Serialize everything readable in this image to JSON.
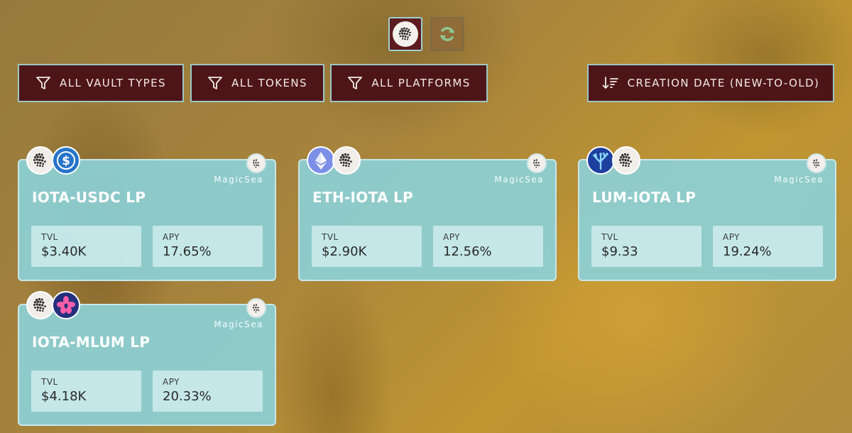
{
  "chains": [
    {
      "name": "IOTA",
      "icon": "iota-icon",
      "active": true
    },
    {
      "name": "Other chain",
      "icon": "refresh-cycle-icon",
      "active": false
    }
  ],
  "filters": {
    "vault_types": "ALL VAULT TYPES",
    "tokens": "ALL TOKENS",
    "platforms": "ALL PLATFORMS",
    "sort": "CREATION DATE (NEW-TO-OLD)"
  },
  "colors": {
    "button_bg": "#4e1518",
    "button_border": "#9bc7c6",
    "card_bg": "#8cd0d6",
    "background": "#a7843c"
  },
  "vaults": [
    {
      "name": "IOTA-USDC LP",
      "platform": "MagicSea",
      "tvl_label": "TVL",
      "tvl": "$3.40K",
      "apy_label": "APY",
      "apy": "17.65%",
      "tokens": [
        "iota-icon",
        "usdc-icon"
      ]
    },
    {
      "name": "ETH-IOTA LP",
      "platform": "MagicSea",
      "tvl_label": "TVL",
      "tvl": "$2.90K",
      "apy_label": "APY",
      "apy": "12.56%",
      "tokens": [
        "eth-icon",
        "iota-icon"
      ]
    },
    {
      "name": "LUM-IOTA LP",
      "platform": "MagicSea",
      "tvl_label": "TVL",
      "tvl": "$9.33",
      "apy_label": "APY",
      "apy": "19.24%",
      "tokens": [
        "lum-icon",
        "iota-icon"
      ]
    },
    {
      "name": "IOTA-MLUM LP",
      "platform": "MagicSea",
      "tvl_label": "TVL",
      "tvl": "$4.18K",
      "apy_label": "APY",
      "apy": "20.33%",
      "tokens": [
        "iota-icon",
        "mlum-icon"
      ]
    }
  ]
}
